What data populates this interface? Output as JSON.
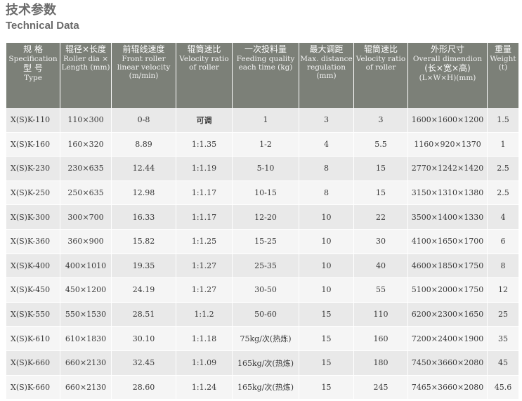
{
  "title": {
    "cn": "技术参数",
    "en": "Technical Data"
  },
  "table": {
    "headers": [
      {
        "cn": "规  格",
        "en": "Specification",
        "cn2": "型  号",
        "en2": "Type"
      },
      {
        "cn": "辊径×长度",
        "en": "Roller dia × Length (mm)"
      },
      {
        "cn": "前辊线速度",
        "en": "Front roller linear velocity (m/min)"
      },
      {
        "cn": "辊筒速比",
        "en": "Velocity ratio of roller"
      },
      {
        "cn": "一次投料量",
        "en": "Feeding quality each time (kg)"
      },
      {
        "cn": "最大调距",
        "en": "Max. distance regulation (mm)"
      },
      {
        "cn": "辊筒速比",
        "en": "Velocity ratio of roller"
      },
      {
        "cn": "外形尺寸",
        "en": "Overall dimendion",
        "cn2": "(长×宽×高)",
        "en2": "(L×W×H)(mm)"
      },
      {
        "cn": "重量",
        "en": "Weight (t)"
      }
    ],
    "rows": [
      {
        "type": "X(S)K-110",
        "dia": "110×300",
        "speed": "0-8",
        "ratio": "可调",
        "feed": "1",
        "dist": "3",
        "ratio2": "3",
        "dim": "1600×1600×1200",
        "weight": "1.5"
      },
      {
        "type": "X(S)K-160",
        "dia": "160×320",
        "speed": "8.89",
        "ratio": "1:1.35",
        "feed": "1-2",
        "dist": "4",
        "ratio2": "5.5",
        "dim": "1160×920×1370",
        "weight": "1"
      },
      {
        "type": "X(S)K-230",
        "dia": "230×635",
        "speed": "12.44",
        "ratio": "1:1.19",
        "feed": "5-10",
        "dist": "8",
        "ratio2": "15",
        "dim": "2770×1242×1420",
        "weight": "2.5"
      },
      {
        "type": "X(S)K-250",
        "dia": "250×635",
        "speed": "12.98",
        "ratio": "1:1.17",
        "feed": "10-15",
        "dist": "8",
        "ratio2": "15",
        "dim": "3150×1310×1380",
        "weight": "2.5"
      },
      {
        "type": "X(S)K-300",
        "dia": "300×700",
        "speed": "16.33",
        "ratio": "1:1.17",
        "feed": "12-20",
        "dist": "10",
        "ratio2": "22",
        "dim": "3500×1400×1330",
        "weight": "4"
      },
      {
        "type": "X(S)K-360",
        "dia": "360×900",
        "speed": "15.82",
        "ratio": "1:1.25",
        "feed": "15-25",
        "dist": "10",
        "ratio2": "30",
        "dim": "4100×1650×1700",
        "weight": "6"
      },
      {
        "type": "X(S)K-400",
        "dia": "400×1010",
        "speed": "19.35",
        "ratio": "1:1.27",
        "feed": "25-35",
        "dist": "10",
        "ratio2": "40",
        "dim": "4600×1850×1750",
        "weight": "8"
      },
      {
        "type": "X(S)K-450",
        "dia": "450×1200",
        "speed": "24.19",
        "ratio": "1:1.27",
        "feed": "30-50",
        "dist": "10",
        "ratio2": "55",
        "dim": "5100×2000×1750",
        "weight": "12"
      },
      {
        "type": "X(S)K-550",
        "dia": "550×1530",
        "speed": "28.51",
        "ratio": "1:1.2",
        "feed": "50-60",
        "dist": "15",
        "ratio2": "110",
        "dim": "6200×2300×1650",
        "weight": "25"
      },
      {
        "type": "X(S)K-610",
        "dia": "610×1830",
        "speed": "30.10",
        "ratio": "1:1.18",
        "feed": "75kg/次(热炼)",
        "dist": "15",
        "ratio2": "160",
        "dim": "7200×2400×1900",
        "weight": "35"
      },
      {
        "type": "X(S)K-660",
        "dia": "660×2130",
        "speed": "32.45",
        "ratio": "1:1.09",
        "feed": "165kg/次(热炼)",
        "dist": "15",
        "ratio2": "180",
        "dim": "7450×3660×2080",
        "weight": "45"
      },
      {
        "type": "X(S)K-660",
        "dia": "660×2130",
        "speed": "28.60",
        "ratio": "1:1.24",
        "feed": "165kg/次(热炼)",
        "dist": "15",
        "ratio2": "245",
        "dim": "7465×3660×2080",
        "weight": "45.6"
      }
    ]
  }
}
